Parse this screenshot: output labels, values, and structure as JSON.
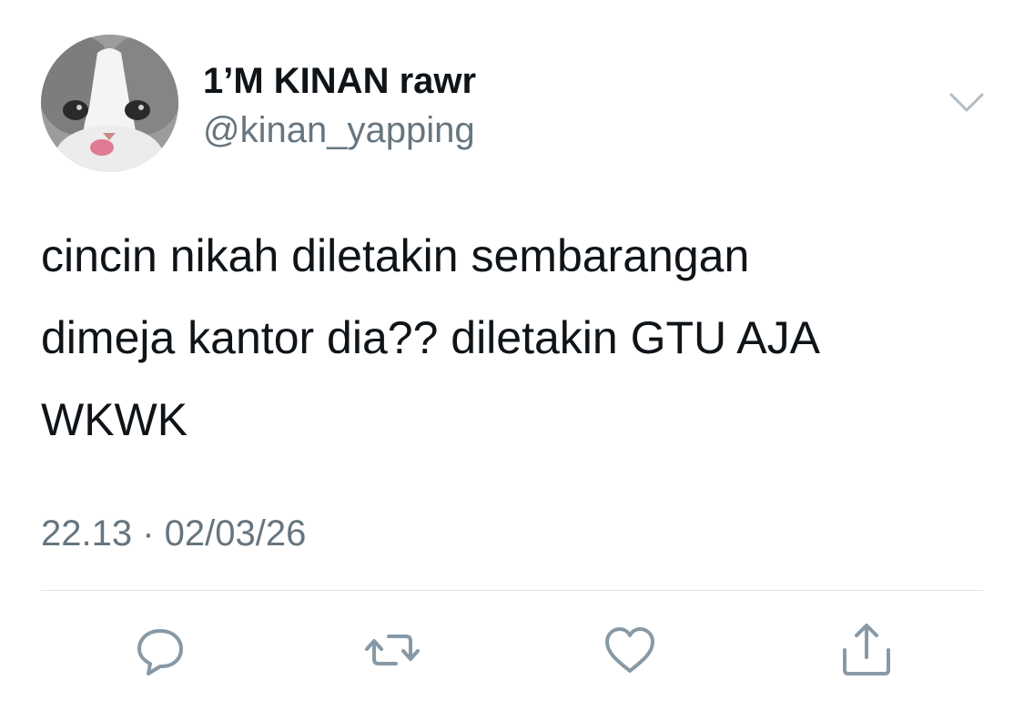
{
  "author": {
    "display_name": "1’M KINAN rawr",
    "handle": "@kinan_yapping",
    "avatar_icon": "cat-avatar"
  },
  "tweet": {
    "lines": [
      "cincin nikah diletakin sembarangan",
      "dimeja kantor dia?? diletakin GTU AJA",
      "WKWK"
    ],
    "timestamp": "22.13 · 02/03/26"
  },
  "actions": [
    {
      "name": "reply",
      "icon": "speech-bubble-icon"
    },
    {
      "name": "retweet",
      "icon": "retweet-arrows-icon"
    },
    {
      "name": "like",
      "icon": "heart-icon"
    },
    {
      "name": "share",
      "icon": "share-upload-icon"
    }
  ],
  "colors": {
    "text_primary": "#0f1419",
    "text_secondary": "#66757f",
    "icon_gray": "#8899a6",
    "divider": "#dde2e6"
  }
}
